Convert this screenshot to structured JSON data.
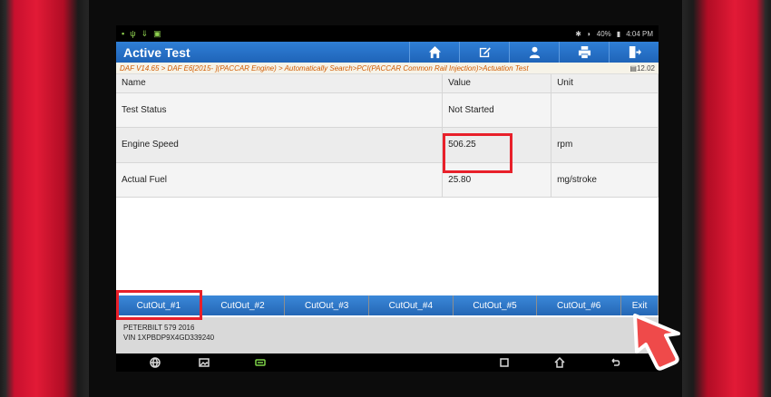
{
  "status_bar": {
    "time": "4:04 PM",
    "battery": "40%"
  },
  "header": {
    "title": "Active Test"
  },
  "toolbar": [
    {
      "name": "home-icon"
    },
    {
      "name": "edit-icon"
    },
    {
      "name": "user-icon"
    },
    {
      "name": "print-icon"
    },
    {
      "name": "exit-door-icon"
    }
  ],
  "breadcrumb": {
    "path": "DAF V14.65 > DAF E6[2015- ](PACCAR Engine) > Automatically Search>PCI(PACCAR Common Rail Injection)>Actuation Test",
    "version": "12.02"
  },
  "table": {
    "headers": {
      "name": "Name",
      "value": "Value",
      "unit": "Unit"
    },
    "rows": [
      {
        "name": "Test Status",
        "value": "Not Started",
        "unit": ""
      },
      {
        "name": "Engine Speed",
        "value": "506.25",
        "unit": "rpm"
      },
      {
        "name": "Actual Fuel",
        "value": "25.80",
        "unit": "mg/stroke"
      }
    ]
  },
  "buttons": {
    "cut1": "CutOut_#1",
    "cut2": "CutOut_#2",
    "cut3": "CutOut_#3",
    "cut4": "CutOut_#4",
    "cut5": "CutOut_#5",
    "cut6": "CutOut_#6",
    "exit": "Exit"
  },
  "vehicle": {
    "model": "PETERBILT 579  2016",
    "vin": "VIN 1XPBDP9X4GD339240"
  },
  "colors": {
    "header_blue": "#1f64b8",
    "highlight_red": "#e8202a",
    "breadcrumb_orange": "#d05a00"
  }
}
